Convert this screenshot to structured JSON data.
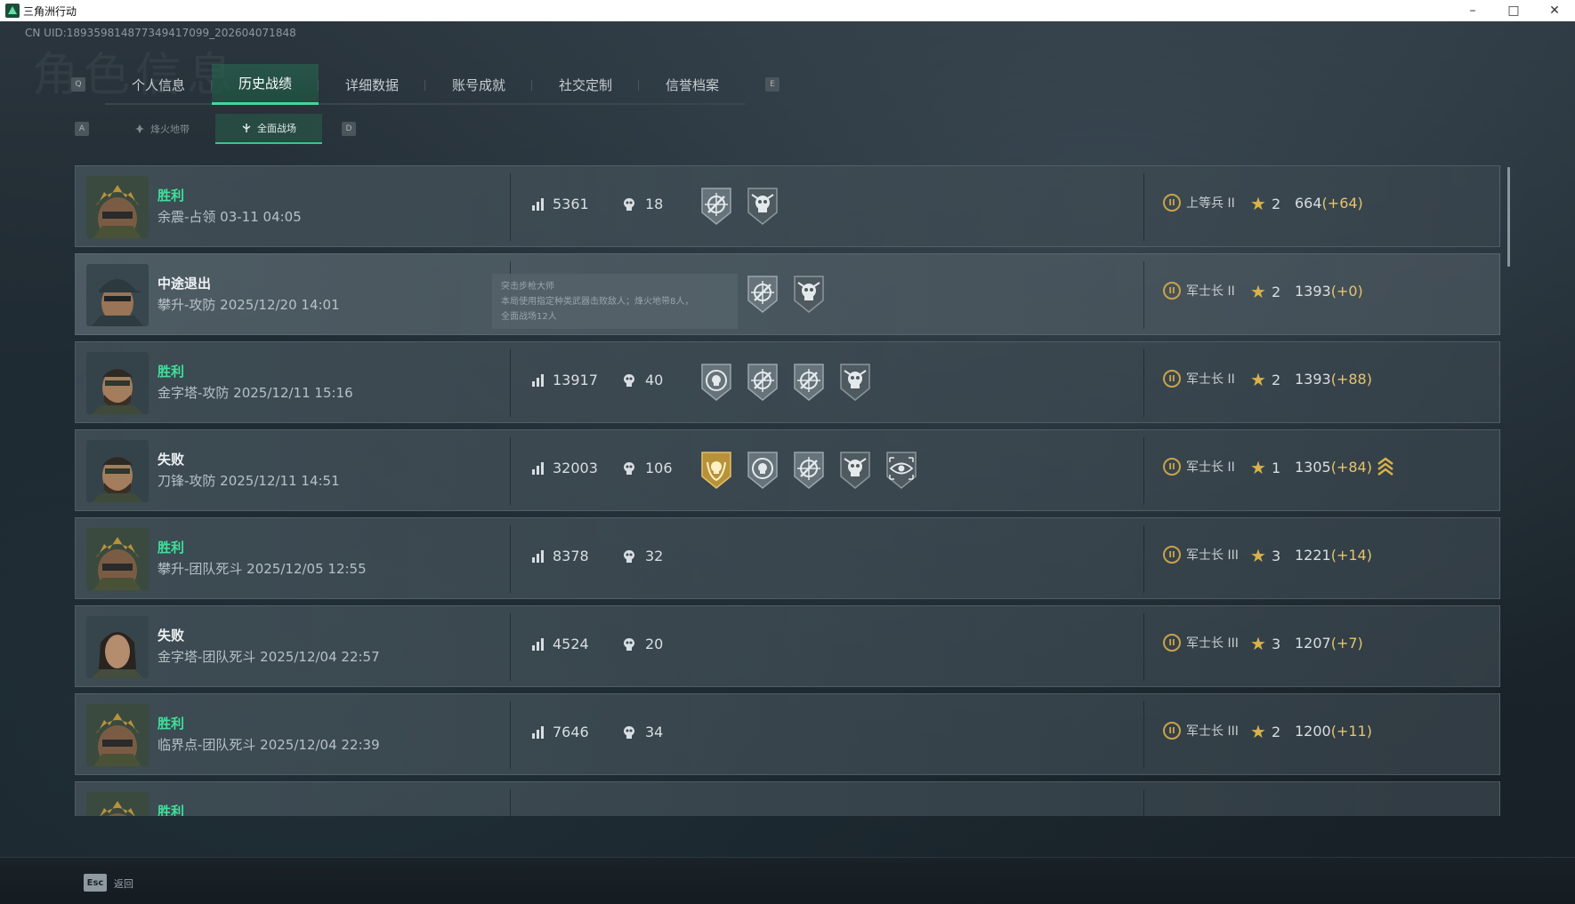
{
  "window": {
    "title": "三角洲行动"
  },
  "header": {
    "uid": "CN UID:1893598148773494170​99_202604071848",
    "watermark": "角色信息"
  },
  "tabs": {
    "key_left": "Q",
    "key_right": "E",
    "items": [
      {
        "label": "个人信息"
      },
      {
        "label": "历史战绩"
      },
      {
        "label": "详细数据"
      },
      {
        "label": "账号成就"
      },
      {
        "label": "社交定制"
      },
      {
        "label": "信誉档案"
      }
    ],
    "active_index": 1
  },
  "subtabs": {
    "key_left": "A",
    "key_right": "D",
    "items": [
      {
        "label": "烽火地带"
      },
      {
        "label": "全面战场"
      }
    ],
    "active_index": 1
  },
  "matches": [
    {
      "result": "胜利",
      "result_type": "win",
      "meta": "余震-占领 03-11 04:05",
      "avatar": "gold-helmet",
      "score": "5361",
      "kills": "18",
      "medals": [
        "crosshair-medal",
        "skull-medal"
      ],
      "rank": "上等兵 II",
      "stars": "2",
      "points": "664",
      "delta": "(+64)"
    },
    {
      "result": "中途退出",
      "result_type": "quit",
      "meta": "攀升-攻防 2025/12/20 14:01",
      "avatar": "cap-soldier",
      "score": "",
      "kills": "",
      "medals": [
        "crosshair-medal",
        "skull-medal"
      ],
      "rank": "军士长 II",
      "stars": "2",
      "points": "1393",
      "delta": "(+0)",
      "tooltip": {
        "title": "突击步枪大师",
        "line1": "本局使用指定种类武器击败敌人；烽火地带8人，",
        "line2": "全面战场12人"
      }
    },
    {
      "result": "胜利",
      "result_type": "win",
      "meta": "金字塔-攻防 2025/12/11 15:16",
      "avatar": "bearded-soldier",
      "score": "13917",
      "kills": "40",
      "medals": [
        "skull-target-medal",
        "crosshair-medal",
        "crosshair-medal",
        "skull-medal"
      ],
      "rank": "军士长 II",
      "stars": "2",
      "points": "1393",
      "delta": "(+88)"
    },
    {
      "result": "失败",
      "result_type": "lose",
      "meta": "刀锋-攻防 2025/12/11 14:51",
      "avatar": "bearded-soldier",
      "score": "32003",
      "kills": "106",
      "medals": [
        "gold-wreath-medal",
        "skull-target-medal",
        "crosshair-medal",
        "skull-medal",
        "eye-target-medal"
      ],
      "rank": "军士长 II",
      "stars": "1",
      "points": "1305",
      "delta": "(+84)",
      "promotion": true
    },
    {
      "result": "胜利",
      "result_type": "win",
      "meta": "攀升-团队死斗 2025/12/05 12:55",
      "avatar": "gold-helmet",
      "score": "8378",
      "kills": "32",
      "medals": [],
      "rank": "军士长 III",
      "stars": "3",
      "points": "1221",
      "delta": "(+14)"
    },
    {
      "result": "失败",
      "result_type": "lose",
      "meta": "金字塔-团队死斗 2025/12/04 22:57",
      "avatar": "female-soldier",
      "score": "4524",
      "kills": "20",
      "medals": [],
      "rank": "军士长 III",
      "stars": "3",
      "points": "1207",
      "delta": "(+7)"
    },
    {
      "result": "胜利",
      "result_type": "win",
      "meta": "临界点-团队死斗 2025/12/04 22:39",
      "avatar": "gold-helmet",
      "score": "7646",
      "kills": "34",
      "medals": [],
      "rank": "军士长 III",
      "stars": "2",
      "points": "1200",
      "delta": "(+11)"
    },
    {
      "result": "胜利",
      "result_type": "win",
      "meta": "",
      "avatar": "gold-helmet",
      "score": "",
      "kills": "",
      "medals": [],
      "rank": "",
      "stars": "",
      "points": "",
      "delta": ""
    }
  ],
  "footer": {
    "esc_key": "Esc",
    "esc_label": "返回"
  },
  "colors": {
    "accent": "#44d59b",
    "win": "#3fe09a",
    "gold": "#d9b24a",
    "delta": "#e5c46a"
  }
}
